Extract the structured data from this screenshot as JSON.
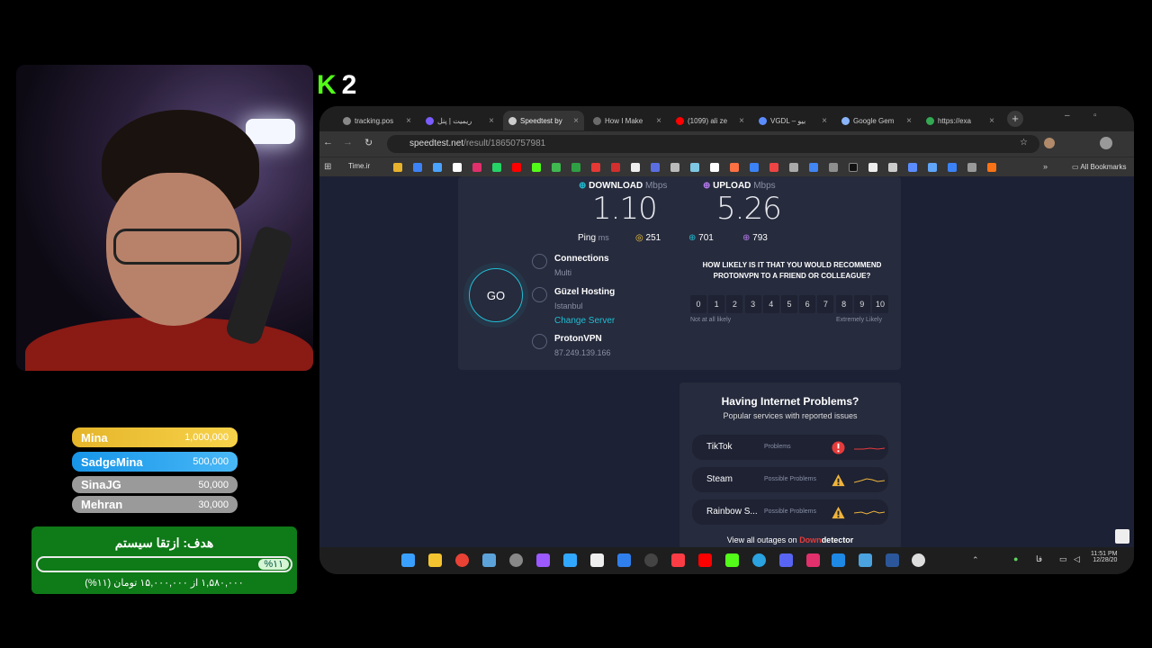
{
  "logo": {
    "k": "K",
    "n": "2"
  },
  "leaderboard": [
    {
      "name": "Mina",
      "amount": "1,000,000"
    },
    {
      "name": "SadgeMina",
      "amount": "500,000"
    },
    {
      "name": "SinaJG",
      "amount": "50,000"
    },
    {
      "name": "Mehran",
      "amount": "30,000"
    }
  ],
  "goal": {
    "title": "هدف: ازتقا سیستم",
    "percent_label": "%۱۱",
    "progress": 0.11,
    "subtitle": "۱,۵۸۰,۰۰۰ از ۱۵,۰۰۰,۰۰۰ تومان (۱۱%)"
  },
  "tabs": [
    {
      "label": "tracking.pos"
    },
    {
      "label": "ریمیت | پنل"
    },
    {
      "label": "Speedtest by"
    },
    {
      "label": "How I Make"
    },
    {
      "label": "(1099) ali ze"
    },
    {
      "label": "VGDL – بیو"
    },
    {
      "label": "Google Gem"
    },
    {
      "label": "https://exa"
    }
  ],
  "address": {
    "host": "speedtest.net",
    "path": "/result/18650757981"
  },
  "bookmarks": {
    "first": "Time.ir",
    "all": "All Bookmarks"
  },
  "speedtest": {
    "download_label": "DOWNLOAD",
    "download_unit": "Mbps",
    "download_value": "1.10",
    "upload_label": "UPLOAD",
    "upload_unit": "Mbps",
    "upload_value": "5.26",
    "ping_label": "Ping",
    "ping_unit": "ms",
    "ping_idle": "251",
    "ping_down": "701",
    "ping_up": "793",
    "go_label": "GO",
    "connections_label": "Connections",
    "connections_value": "Multi",
    "server_name": "Güzel Hosting",
    "server_city": "Istanbul",
    "change_server": "Change Server",
    "isp_name": "ProtonVPN",
    "isp_ip": "87.249.139.166",
    "survey_question": "HOW LIKELY IS IT THAT YOU WOULD RECOMMEND PROTONVPN TO A FRIEND OR COLLEAGUE?",
    "ratings": [
      "0",
      "1",
      "2",
      "3",
      "4",
      "5",
      "6",
      "7",
      "8",
      "9",
      "10"
    ],
    "not_likely": "Not at all likely",
    "extremely_likely": "Extremely Likely"
  },
  "problems": {
    "title": "Having Internet Problems?",
    "subtitle": "Popular services with reported issues",
    "items": [
      {
        "name": "TikTok",
        "status": "Problems",
        "color": "#e63b3b"
      },
      {
        "name": "Steam",
        "status": "Possible Problems",
        "color": "#f0b43c"
      },
      {
        "name": "Rainbow S...",
        "status": "Possible Problems",
        "color": "#f0b43c"
      }
    ],
    "footer": "View all outages on",
    "brand_a": "Down",
    "brand_b": "detector"
  },
  "taskbar": {
    "lang": "فا",
    "time": "11:51 PM",
    "date": "12/28/20"
  }
}
